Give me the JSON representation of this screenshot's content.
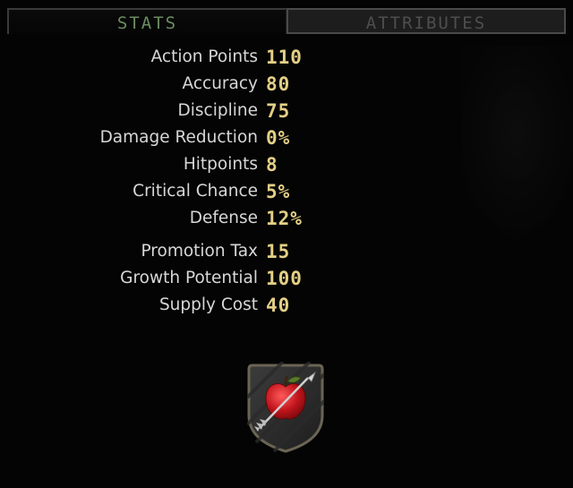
{
  "tabs": {
    "stats_label": "STATS",
    "attributes_label": "ATTRIBUTES",
    "active": "STATS"
  },
  "stats": [
    {
      "label": "Action Points",
      "value": "110"
    },
    {
      "label": "Accuracy",
      "value": "80"
    },
    {
      "label": "Discipline",
      "value": "75"
    },
    {
      "label": "Damage Reduction",
      "value": "0%"
    },
    {
      "label": "Hitpoints",
      "value": "8"
    },
    {
      "label": "Critical Chance",
      "value": "5%"
    },
    {
      "label": "Defense",
      "value": "12%"
    }
  ],
  "economy": [
    {
      "label": "Promotion Tax",
      "value": "15"
    },
    {
      "label": "Growth Potential",
      "value": "100"
    },
    {
      "label": "Supply Cost",
      "value": "40"
    }
  ],
  "badge": {
    "icon": "apple-arrow-icon"
  },
  "colors": {
    "label": "#d7d7d7",
    "value": "#e3cf86",
    "active_tab_text": "#6b8c61",
    "inactive_tab_text": "#4e4e4e",
    "apple_red": "#c0141c"
  }
}
